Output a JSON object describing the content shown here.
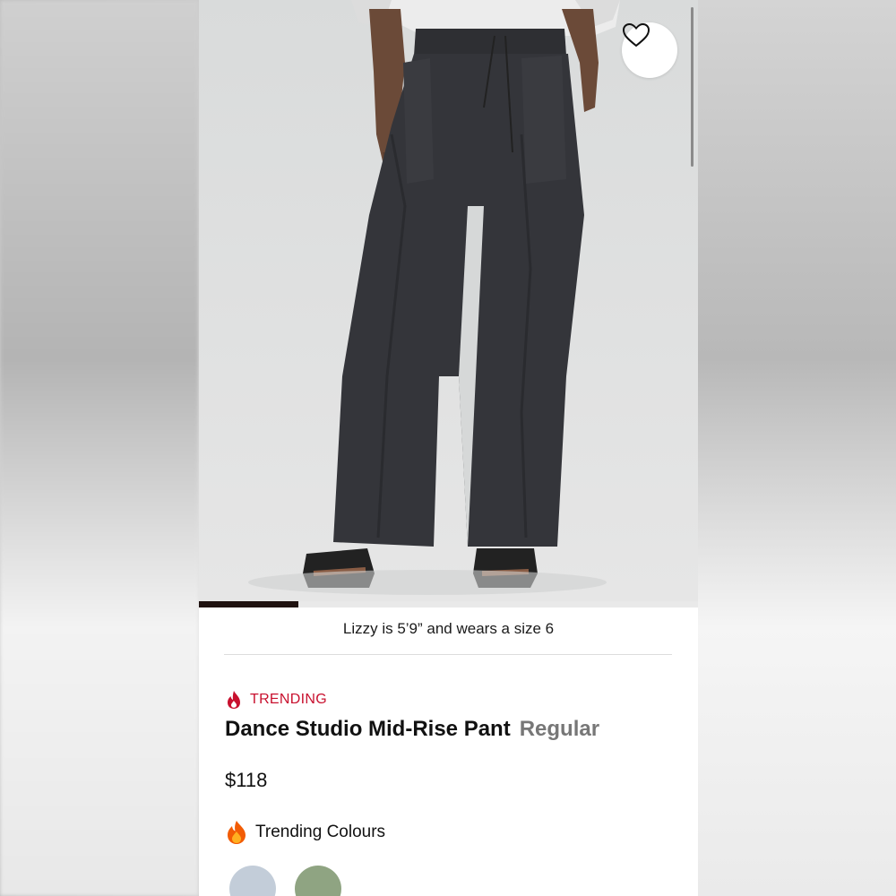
{
  "product": {
    "model_caption": "Lizzy is 5’9” and wears a size 6",
    "badge": "TRENDING",
    "name": "Dance Studio Mid-Rise Pant",
    "fit": "Regular",
    "price": "$118",
    "colours_label": "Trending Colours",
    "swatches": [
      {
        "name": "light-blue",
        "color": "#c3cdd9"
      },
      {
        "name": "sage-green",
        "color": "#8fa482"
      }
    ]
  },
  "gallery": {
    "progress": 0.2
  },
  "colors": {
    "accent_red": "#c8102e",
    "progress_fill": "#1f1210"
  },
  "icons": {
    "favorite": "heart-outline-icon",
    "trending_badge": "flame-icon",
    "colours": "fire-emoji-icon"
  }
}
